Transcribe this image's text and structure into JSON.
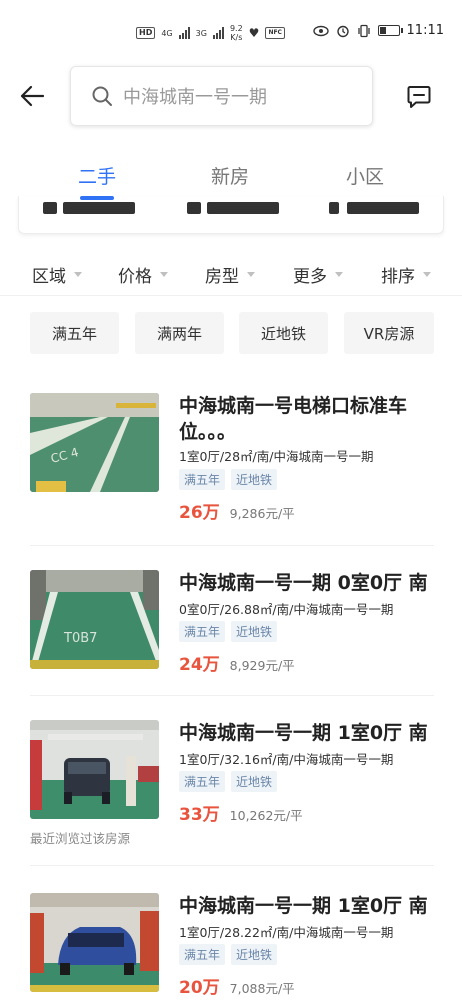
{
  "status_bar": {
    "hd_label": "HD",
    "network_1": "4G",
    "network_2": "3G",
    "speed_value": "9.2",
    "speed_unit": "K/s",
    "nfc_label": "NFC",
    "time": "11:11",
    "battery_level": 0.35,
    "icons": [
      "eye-icon",
      "alarm-icon",
      "vibrate-icon",
      "battery-icon"
    ]
  },
  "header": {
    "search_placeholder": "中海城南一号一期",
    "icons": [
      "back-arrow-icon",
      "search-icon",
      "message-icon"
    ]
  },
  "tabs": [
    {
      "label": "二手",
      "active": true
    },
    {
      "label": "新房",
      "active": false
    },
    {
      "label": "小区",
      "active": false
    }
  ],
  "filters": [
    {
      "label": "区域"
    },
    {
      "label": "价格"
    },
    {
      "label": "房型"
    },
    {
      "label": "更多"
    },
    {
      "label": "排序"
    }
  ],
  "quick_tags": [
    "满五年",
    "满两年",
    "近地铁",
    "VR房源"
  ],
  "listings": [
    {
      "title": "中海城南一号电梯口标准车位。。。",
      "info": "1室0厅/28㎡/南/中海城南一号一期",
      "tags": [
        "满五年",
        "近地铁"
      ],
      "price": "26万",
      "unit_price": "9,286元/平"
    },
    {
      "title": "中海城南一号一期 0室0厅 南",
      "info": "0室0厅/26.88㎡/南/中海城南一号一期",
      "tags": [
        "满五年",
        "近地铁"
      ],
      "price": "24万",
      "unit_price": "8,929元/平"
    },
    {
      "title": "中海城南一号一期 1室0厅 南",
      "info": "1室0厅/32.16㎡/南/中海城南一号一期",
      "tags": [
        "满五年",
        "近地铁"
      ],
      "price": "33万",
      "unit_price": "10,262元/平",
      "note": "最近浏览过该房源"
    },
    {
      "title": "中海城南一号一期 1室0厅 南",
      "info": "1室0厅/28.22㎡/南/中海城南一号一期",
      "tags": [
        "满五年",
        "近地铁"
      ],
      "price": "20万",
      "unit_price": "7,088元/平"
    }
  ],
  "colors": {
    "accent": "#3072f6",
    "price": "#e8543e",
    "tag_text": "#6a86a8",
    "tag_bg": "#eef3f8"
  }
}
